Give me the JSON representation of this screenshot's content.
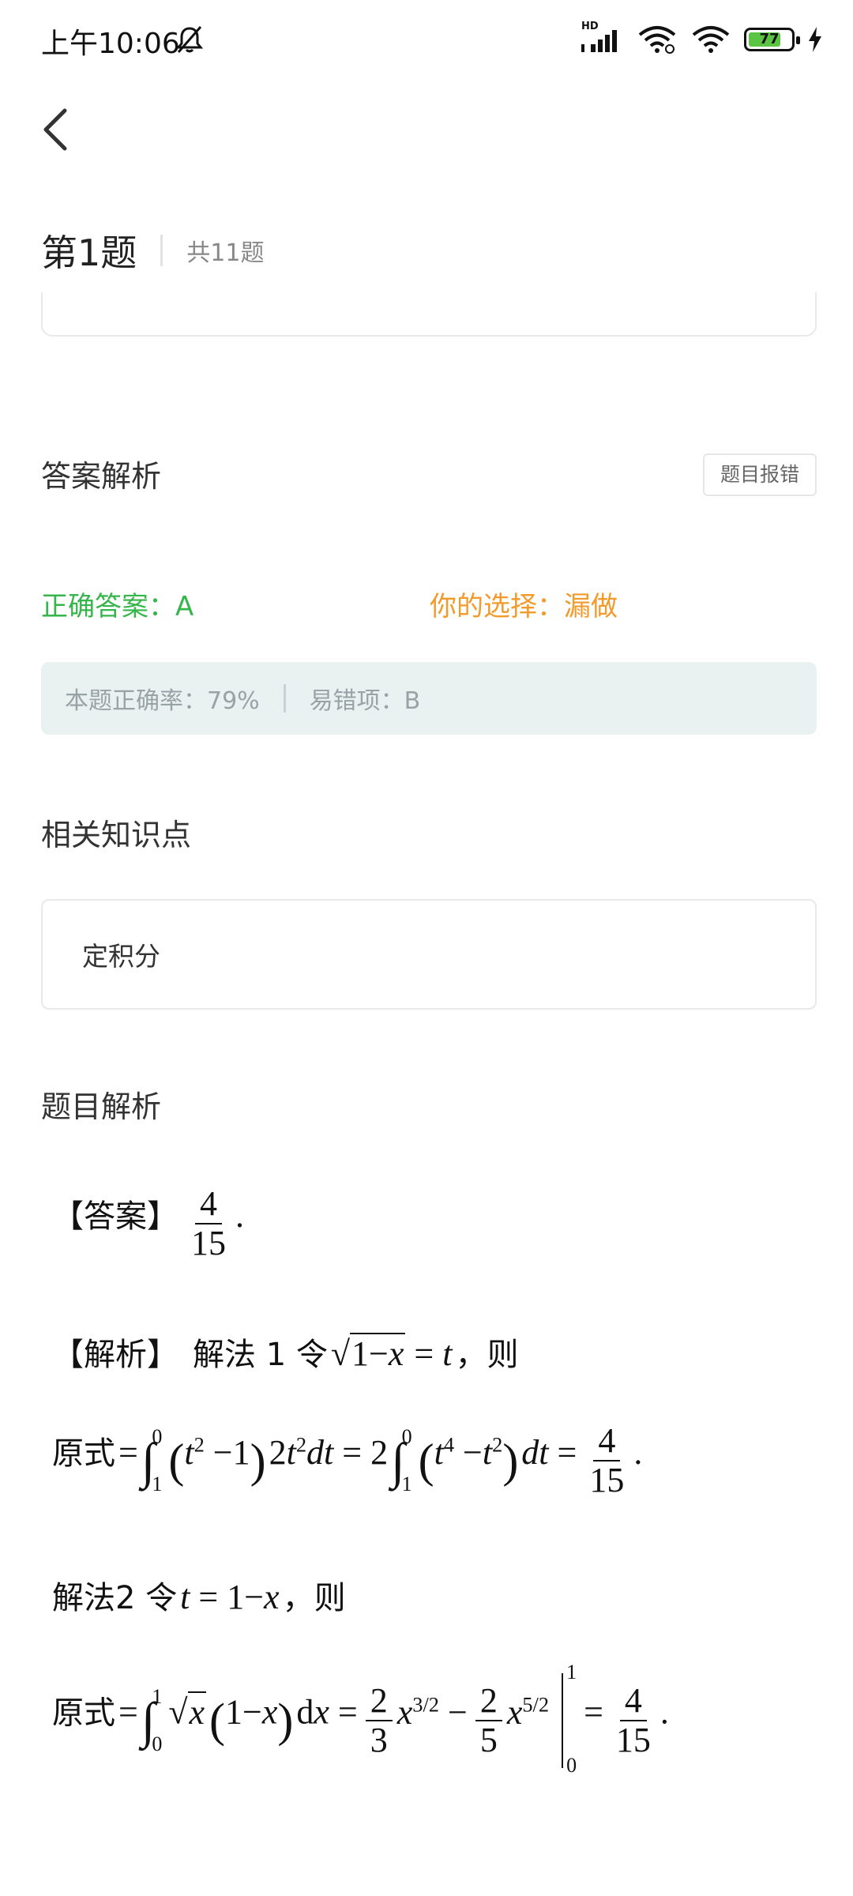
{
  "status_bar": {
    "time": "上午10:06",
    "signal_label": "HD",
    "battery": "77",
    "battery_level": 0.77
  },
  "header": {
    "question_title": "第1题",
    "total": "共11题"
  },
  "answer_section": {
    "title": "答案解析",
    "report_button": "题目报错",
    "correct_answer": "正确答案：A",
    "your_choice": "你的选择：漏做",
    "accuracy": "本题正确率：79%",
    "common_error": "易错项：B"
  },
  "knowledge": {
    "title": "相关知识点",
    "item": "定积分"
  },
  "analysis": {
    "title": "题目解析",
    "answer_label": "【答案】",
    "answer_num": "4",
    "answer_den": "15",
    "jiexi_label": "【解析】",
    "method1_text": "解法 1  令",
    "then_text": "，则",
    "yuanshi": "原式",
    "method2_text": "解法2  令",
    "then_text2": "，则"
  },
  "colors": {
    "correct": "#36b54a",
    "choice": "#f39a2b",
    "stats_bg": "#eaf1f1",
    "battery": "#5cc443"
  }
}
